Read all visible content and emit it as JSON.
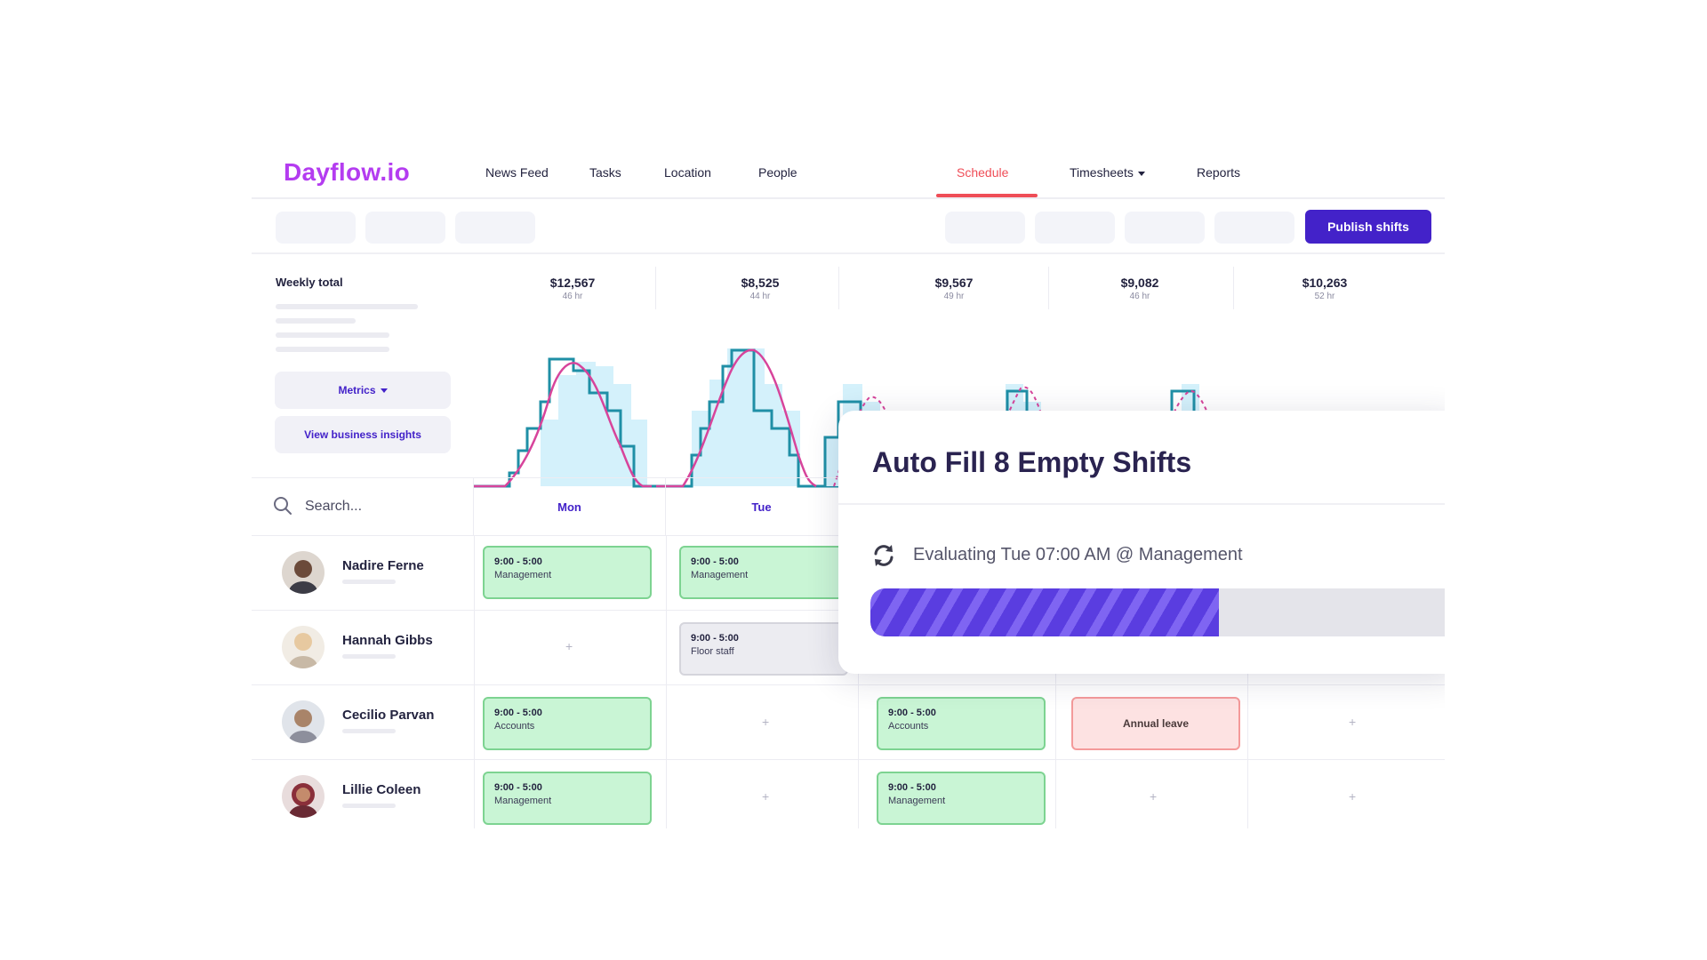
{
  "app": {
    "logo": "Dayflow.io",
    "nav": [
      {
        "label": "News Feed"
      },
      {
        "label": "Tasks"
      },
      {
        "label": "Location"
      },
      {
        "label": "People"
      },
      {
        "label": "Schedule",
        "active": true
      },
      {
        "label": "Timesheets",
        "has_dropdown": true
      },
      {
        "label": "Reports"
      }
    ],
    "accent_color": "#ef4d57",
    "brand_color": "#b43cf0",
    "primary_color": "#4322c9"
  },
  "toolbar": {
    "publish_label": "Publish shifts"
  },
  "metrics_panel": {
    "weekly_total_label": "Weekly total",
    "metrics_button": "Metrics",
    "insights_button": "View business insights"
  },
  "days": [
    {
      "amount": "$12,567",
      "hours": "46 hr",
      "header": "Mon"
    },
    {
      "amount": "$8,525",
      "hours": "44 hr",
      "header": "Tue"
    },
    {
      "amount": "$9,567",
      "hours": "49 hr"
    },
    {
      "amount": "$9,082",
      "hours": "46 hr"
    },
    {
      "amount": "$10,263",
      "hours": "52 hr"
    }
  ],
  "search": {
    "placeholder": "Search..."
  },
  "employees": [
    {
      "name": "Nadire Ferne",
      "shifts": [
        {
          "day": "Mon",
          "time": "9:00 - 5:00",
          "role": "Management",
          "status": "green"
        },
        {
          "day": "Tue",
          "time": "9:00 - 5:00",
          "role": "Management",
          "status": "green"
        }
      ]
    },
    {
      "name": "Hannah Gibbs",
      "shifts": [
        {
          "day": "Tue",
          "time": "9:00 - 5:00",
          "role": "Floor staff",
          "status": "grey"
        }
      ]
    },
    {
      "name": "Cecilio Parvan",
      "shifts": [
        {
          "day": "Mon",
          "time": "9:00 - 5:00",
          "role": "Accounts",
          "status": "green"
        },
        {
          "day": "Wed",
          "time": "9:00 - 5:00",
          "role": "Accounts",
          "status": "green"
        },
        {
          "day": "Thu",
          "label": "Annual leave",
          "status": "leave"
        }
      ]
    },
    {
      "name": "Lillie Coleen",
      "shifts": [
        {
          "day": "Mon",
          "time": "9:00 - 5:00",
          "role": "Management",
          "status": "green"
        },
        {
          "day": "Wed",
          "time": "9:00 - 5:00",
          "role": "Management",
          "status": "green"
        }
      ]
    }
  ],
  "modal": {
    "title": "Auto Fill 8 Empty Shifts",
    "status_text": "Evaluating Tue 07:00 AM @ Management",
    "progress": 0.59
  },
  "icons": [
    "search-icon",
    "sync-icon",
    "chevron-down-icon",
    "plus-icon"
  ]
}
